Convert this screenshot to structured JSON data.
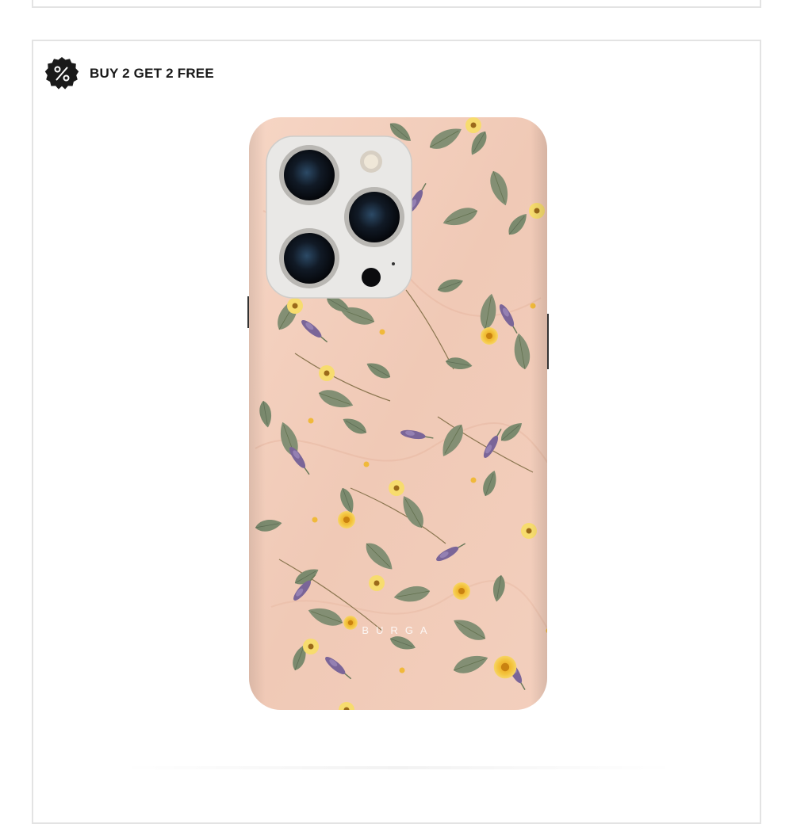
{
  "promo": {
    "icon": "percent-badge-icon",
    "label": "BUY 2 GET 2 FREE"
  },
  "product": {
    "brand_mark": "BURGA"
  },
  "colors": {
    "badge": "#1a1a1a",
    "case_base": "#f1cdbb",
    "leaf": "#7b8a6e",
    "flower": "#f3c23a",
    "lavender": "#7a6598",
    "camera_housing": "#e9e8e6",
    "border": "#e3e3e3"
  }
}
